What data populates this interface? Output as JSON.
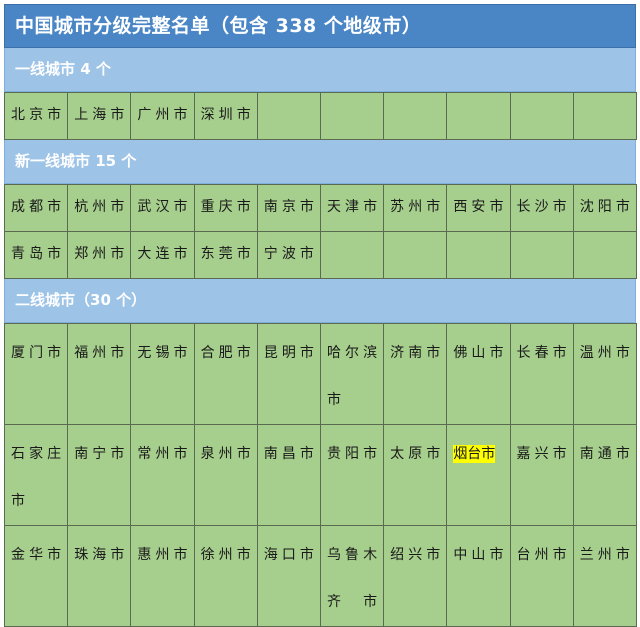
{
  "title": "中国城市分级完整名单（包含 338 个地级市）",
  "colors": {
    "title_bar": "#4a86c5",
    "section_band": "#9dc3e6",
    "cell": "#a6ce8d",
    "cell_border": "#5a6b52",
    "highlight": "#ffff00",
    "header_text": "#ffffff",
    "cell_text": "#1a1a1a"
  },
  "columns": 10,
  "sections": [
    {
      "header": "一线城市 4 个",
      "tier": "tier-1",
      "rows": [
        [
          "北京市",
          "上海市",
          "广州市",
          "深圳市",
          "",
          "",
          "",
          "",
          "",
          ""
        ]
      ]
    },
    {
      "header": "新一线城市 15 个",
      "tier": "new-tier-1",
      "rows": [
        [
          "成都市",
          "杭州市",
          "武汉市",
          "重庆市",
          "南京市",
          "天津市",
          "苏州市",
          "西安市",
          "长沙市",
          "沈阳市"
        ],
        [
          "青岛市",
          "郑州市",
          "大连市",
          "东莞市",
          "宁波市",
          "",
          "",
          "",
          "",
          ""
        ]
      ]
    },
    {
      "header": "二线城市（30 个）",
      "tier": "tier-2",
      "rows": [
        [
          "厦门市",
          "福州市",
          "无锡市",
          "合肥市",
          "昆明市",
          "哈尔滨市",
          "济南市",
          "佛山市",
          "长春市",
          "温州市"
        ],
        [
          "石家庄市",
          "南宁市",
          "常州市",
          "泉州市",
          "南昌市",
          "贵阳市",
          "太原市",
          "烟台市",
          "嘉兴市",
          "南通市"
        ],
        [
          "金华市",
          "珠海市",
          "惠州市",
          "徐州市",
          "海口市",
          "乌鲁木齐市",
          "绍兴市",
          "中山市",
          "台州市",
          "兰州市"
        ]
      ]
    }
  ],
  "highlighted_cells": [
    "烟台市"
  ]
}
